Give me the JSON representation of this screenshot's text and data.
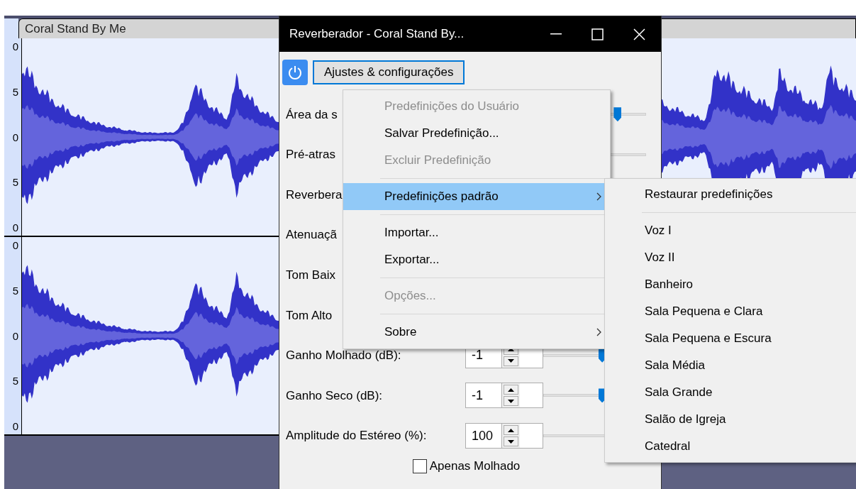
{
  "track": {
    "name": "Coral Stand By Me",
    "ruler_labels": [
      [
        "0",
        "5",
        "0",
        "5",
        "0"
      ],
      [
        "0",
        "5",
        "0",
        "5",
        "0"
      ]
    ]
  },
  "dialog": {
    "title": "Reverberador - Coral Stand By...",
    "settings_button": "Ajustes & configurações",
    "power_on": true,
    "rows": [
      {
        "label": "Área da s",
        "slider": {
          "level": 0.72
        }
      },
      {
        "label": "Pré-atras",
        "slider": {}
      },
      {
        "label": "Reverbera"
      },
      {
        "label": "Atenuaçã"
      },
      {
        "label": "Tom Baix"
      },
      {
        "label": "Tom Alto"
      },
      {
        "label": "Ganho Molhado (dB):",
        "value": "-1",
        "slider": {
          "level": 0.57
        }
      },
      {
        "label": "Ganho Seco (dB):",
        "value": "-1",
        "slider": {
          "level": 0.57
        }
      },
      {
        "label": "Amplitude do Estéreo (%):",
        "value": "100",
        "slider": {}
      }
    ],
    "checkbox": {
      "label": "Apenas Molhado",
      "checked": false
    }
  },
  "menu": [
    {
      "kind": "item",
      "label": "Predefinições do Usuário",
      "disabled": true,
      "selected": false,
      "submenu": false
    },
    {
      "kind": "item",
      "label": "Salvar Predefinição...",
      "disabled": false,
      "selected": false,
      "submenu": false
    },
    {
      "kind": "item",
      "label": "Excluir Predefinição",
      "disabled": true,
      "selected": false,
      "submenu": false
    },
    {
      "kind": "separator"
    },
    {
      "kind": "item",
      "label": "Predefinições padrão",
      "disabled": false,
      "selected": true,
      "submenu": true
    },
    {
      "kind": "separator"
    },
    {
      "kind": "item",
      "label": "Importar...",
      "disabled": false,
      "selected": false,
      "submenu": false
    },
    {
      "kind": "item",
      "label": "Exportar...",
      "disabled": false,
      "selected": false,
      "submenu": false
    },
    {
      "kind": "separator"
    },
    {
      "kind": "item",
      "label": "Opções...",
      "disabled": true,
      "selected": false,
      "submenu": false
    },
    {
      "kind": "separator"
    },
    {
      "kind": "item",
      "label": "Sobre",
      "disabled": false,
      "selected": false,
      "submenu": true
    }
  ],
  "submenu": [
    {
      "kind": "item",
      "label": "Restaurar predefinições"
    },
    {
      "kind": "separator"
    },
    {
      "kind": "item",
      "label": "Voz I"
    },
    {
      "kind": "item",
      "label": "Voz II"
    },
    {
      "kind": "item",
      "label": "Banheiro"
    },
    {
      "kind": "item",
      "label": "Sala Pequena e Clara"
    },
    {
      "kind": "item",
      "label": "Sala Pequena e Escura"
    },
    {
      "kind": "item",
      "label": "Sala Média"
    },
    {
      "kind": "item",
      "label": "Sala Grande"
    },
    {
      "kind": "item",
      "label": "Salão de Igreja"
    },
    {
      "kind": "item",
      "label": "Catedral"
    }
  ]
}
